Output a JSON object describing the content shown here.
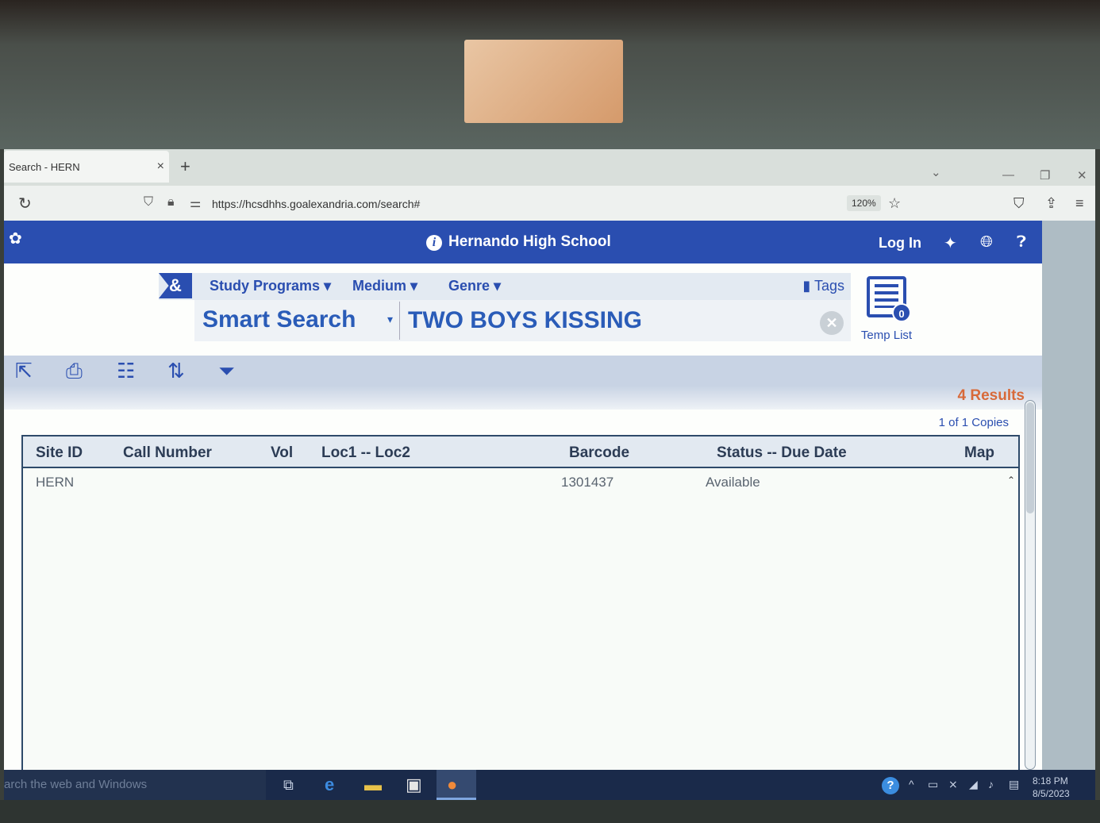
{
  "browser": {
    "tab_title": "Search - HERN",
    "tab_close": "×",
    "new_tab": "+",
    "url": "https://hcsdhhs.goalexandria.com/search#",
    "zoom": "120%"
  },
  "header": {
    "school": "Hernando High School",
    "login": "Log In"
  },
  "filters": {
    "amp": "&",
    "study_programs": "Study Programs",
    "medium": "Medium",
    "genre": "Genre",
    "tags": "Tags"
  },
  "search": {
    "mode": "Smart Search",
    "query": "TWO BOYS KISSING"
  },
  "temp_list": {
    "label": "Temp List",
    "count": "0"
  },
  "results": {
    "count_label": "4 Results",
    "copies": "1 of 1 Copies"
  },
  "table": {
    "headers": [
      "Site ID",
      "Call Number",
      "Vol",
      "Loc1 -- Loc2",
      "Barcode",
      "Status -- Due Date",
      "Map"
    ],
    "rows": [
      {
        "site_id": "HERN",
        "call_number": "",
        "vol": "",
        "loc": "",
        "barcode": "1301437",
        "status": "Available",
        "map": ""
      }
    ]
  },
  "taskbar": {
    "search_placeholder": "arch the web and Windows",
    "time": "8:18 PM",
    "date": "8/5/2023"
  }
}
